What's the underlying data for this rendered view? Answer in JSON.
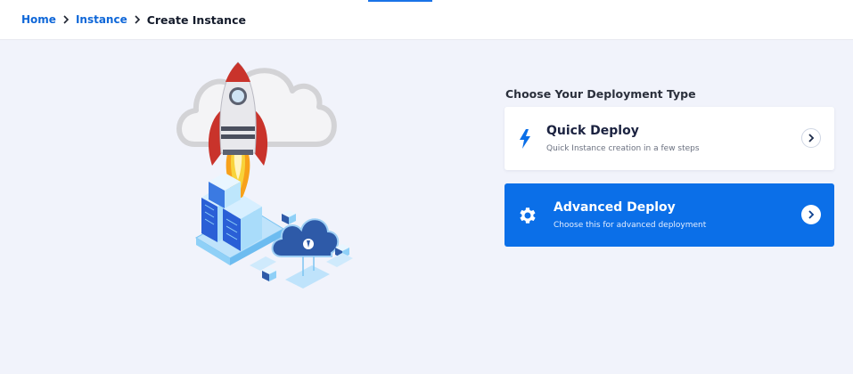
{
  "breadcrumb": {
    "items": [
      "Home",
      "Instance"
    ],
    "current": "Create Instance"
  },
  "deployment": {
    "heading": "Choose Your Deployment Type",
    "options": [
      {
        "title": "Quick Deploy",
        "description": "Quick Instance creation in a few steps",
        "icon": "lightning-icon",
        "selected": false
      },
      {
        "title": "Advanced Deploy",
        "description": "Choose this for advanced deployment",
        "icon": "gear-icon",
        "selected": true
      }
    ]
  },
  "colors": {
    "accent": "#0b6fe8",
    "link": "#0f67d8",
    "background": "#f1f3fb"
  },
  "illustration": {
    "icon": "rocket-cloud-server-illustration"
  }
}
